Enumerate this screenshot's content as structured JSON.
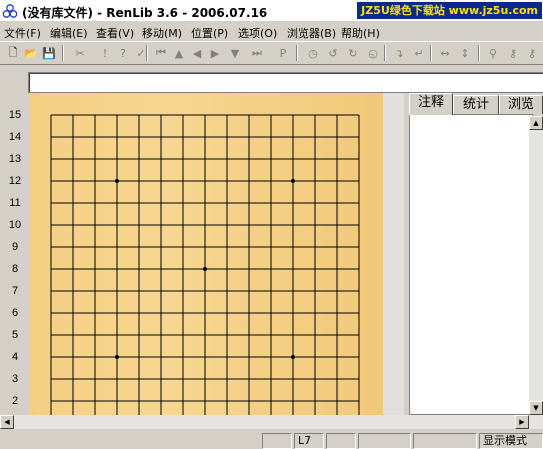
{
  "window": {
    "title": "(没有库文件) - RenLib 3.6 - 2006.07.16",
    "watermark": "JZ5U绿色下载站 www.jz5u.com"
  },
  "menu": [
    {
      "label": "文件(F)"
    },
    {
      "label": "编辑(E)"
    },
    {
      "label": "查看(V)"
    },
    {
      "label": "移动(M)"
    },
    {
      "label": "位置(P)"
    },
    {
      "label": "选项(O)"
    },
    {
      "label": "浏览器(B)"
    },
    {
      "label": "帮助(H)"
    }
  ],
  "toolbar": {
    "buttons": [
      {
        "name": "new-file-icon",
        "glyph": "🗋",
        "enabled": true
      },
      {
        "name": "open-folder-icon",
        "glyph": "📂",
        "enabled": true
      },
      {
        "name": "save-icon",
        "glyph": "💾",
        "enabled": false
      },
      {
        "name": "cut-icon",
        "glyph": "✂",
        "enabled": false
      },
      {
        "name": "exclamation-icon",
        "glyph": "!",
        "enabled": false
      },
      {
        "name": "question-icon",
        "glyph": "?",
        "enabled": false
      },
      {
        "name": "checkmark-icon",
        "glyph": "✓",
        "enabled": false
      },
      {
        "name": "first-move-icon",
        "glyph": "⏮",
        "enabled": false
      },
      {
        "name": "up-icon",
        "glyph": "▲",
        "enabled": false
      },
      {
        "name": "back-icon",
        "glyph": "◀",
        "enabled": false
      },
      {
        "name": "forward-icon",
        "glyph": "▶",
        "enabled": false
      },
      {
        "name": "down-icon",
        "glyph": "▼",
        "enabled": false
      },
      {
        "name": "last-move-icon",
        "glyph": "⏭",
        "enabled": false
      },
      {
        "name": "position-p-icon",
        "glyph": "P",
        "enabled": false
      },
      {
        "name": "clock-icon",
        "glyph": "◷",
        "enabled": false
      },
      {
        "name": "rotate-left-icon",
        "glyph": "↺",
        "enabled": false
      },
      {
        "name": "rotate-right-icon",
        "glyph": "↻",
        "enabled": false
      },
      {
        "name": "rotate-back-icon",
        "glyph": "◵",
        "enabled": false
      },
      {
        "name": "turn-down-right-icon",
        "glyph": "↴",
        "enabled": false
      },
      {
        "name": "turn-down-left-icon",
        "glyph": "↵",
        "enabled": false
      },
      {
        "name": "flip-horizontal-icon",
        "glyph": "↔",
        "enabled": false
      },
      {
        "name": "flip-vertical-icon",
        "glyph": "↕",
        "enabled": false
      },
      {
        "name": "find-icon",
        "glyph": "⚲",
        "enabled": false
      },
      {
        "name": "key-icon",
        "glyph": "⚷",
        "enabled": false
      },
      {
        "name": "key-alt-icon",
        "glyph": "⚷",
        "enabled": false
      }
    ]
  },
  "board": {
    "row_labels": [
      "15",
      "14",
      "13",
      "12",
      "11",
      "10",
      "9",
      "8",
      "7",
      "6",
      "5",
      "4",
      "3",
      "2"
    ],
    "size": 15
  },
  "side_panel": {
    "tabs": [
      {
        "label": "注释",
        "active": true
      },
      {
        "label": "统计",
        "active": false
      },
      {
        "label": "浏览",
        "active": false
      }
    ]
  },
  "status": {
    "position": "L7",
    "mode": "显示模式"
  },
  "colors": {
    "board": "#f4cf82",
    "grid": "#000000",
    "chrome": "#d4d0c8",
    "watermark_bg": "#0a2a8a",
    "watermark_text": "#ffe000"
  }
}
